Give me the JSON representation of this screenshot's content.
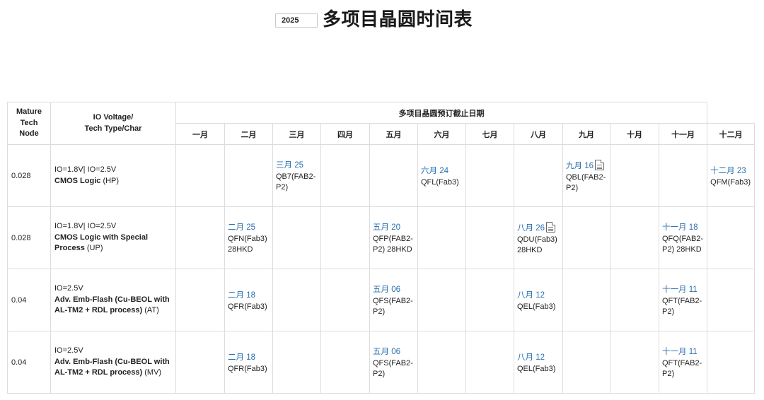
{
  "header": {
    "year": "2025",
    "title": "多项目晶圆时间表"
  },
  "table": {
    "col_node": "Mature Tech Node",
    "col_desc": "IO Voltage/\nTech Type/Char",
    "group_title": "多项目晶圆预订截止日期",
    "months": [
      "一月",
      "二月",
      "三月",
      "四月",
      "五月",
      "六月",
      "七月",
      "八月",
      "九月",
      "十月",
      "十一月",
      "十二月"
    ],
    "rows": [
      {
        "node": "0.028",
        "io": "IO=1.8V| IO=2.5V",
        "type": "CMOS Logic",
        "char": " (HP)",
        "cells": {
          "2": {
            "date": "三月 25",
            "text": "QB7(FAB2-P2)"
          },
          "5": {
            "date": "六月 24",
            "text": "QFL(Fab3)"
          },
          "8": {
            "date": "九月 16",
            "text": "QBL(FAB2-P2)",
            "icon": "document-icon"
          },
          "11": {
            "date": "十二月 23",
            "text": "QFM(Fab3)"
          }
        }
      },
      {
        "node": "0.028",
        "io": "IO=1.8V| IO=2.5V",
        "type": "CMOS Logic with Special Process",
        "char": " (UP)",
        "cells": {
          "1": {
            "date": "二月 25",
            "text": "QFN(Fab3) 28HKD"
          },
          "4": {
            "date": "五月 20",
            "text": "QFP(FAB2-P2) 28HKD"
          },
          "7": {
            "date": "八月 26",
            "text": "QDU(Fab3) 28HKD",
            "icon": "document-icon"
          },
          "10": {
            "date": "十一月 18",
            "text": "QFQ(FAB2-P2) 28HKD"
          }
        }
      },
      {
        "node": "0.04",
        "io": "IO=2.5V",
        "type": "Adv. Emb-Flash (Cu-BEOL with AL-TM2 + RDL process)",
        "char": " (AT)",
        "cells": {
          "1": {
            "date": "二月 18",
            "text": "QFR(Fab3)"
          },
          "4": {
            "date": "五月 06",
            "text": "QFS(FAB2-P2)"
          },
          "7": {
            "date": "八月 12",
            "text": "QEL(Fab3)"
          },
          "10": {
            "date": "十一月 11",
            "text": "QFT(FAB2-P2)"
          }
        }
      },
      {
        "node": "0.04",
        "io": "IO=2.5V",
        "type": "Adv. Emb-Flash (Cu-BEOL with AL-TM2 + RDL process)",
        "char": " (MV)",
        "cells": {
          "1": {
            "date": "二月 18",
            "text": "QFR(Fab3)"
          },
          "4": {
            "date": "五月 06",
            "text": "QFS(FAB2-P2)"
          },
          "7": {
            "date": "八月 12",
            "text": "QEL(Fab3)"
          },
          "10": {
            "date": "十一月 11",
            "text": "QFT(FAB2-P2)"
          }
        }
      }
    ]
  }
}
